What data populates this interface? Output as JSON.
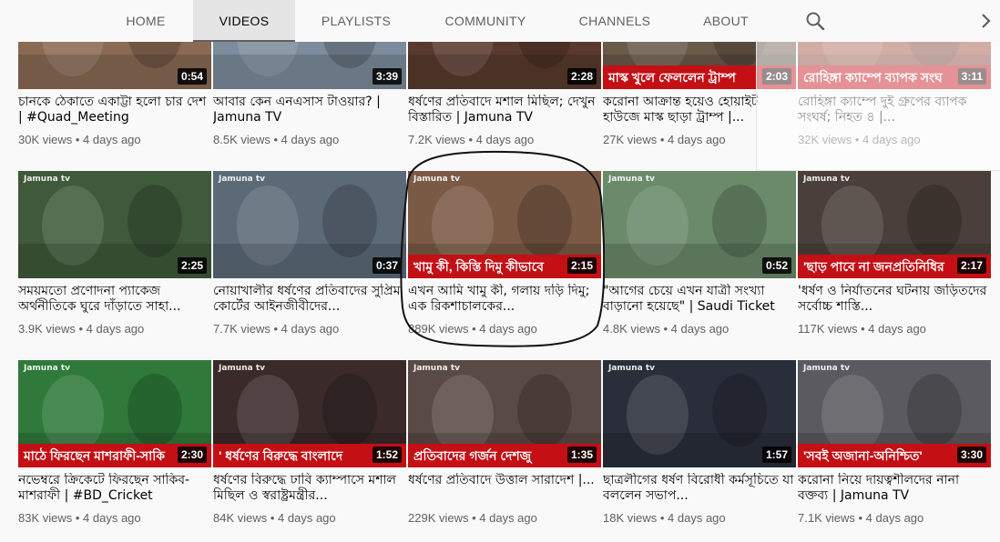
{
  "tabs": {
    "items": [
      {
        "label": "HOME"
      },
      {
        "label": "VIDEOS"
      },
      {
        "label": "PLAYLISTS"
      },
      {
        "label": "COMMUNITY"
      },
      {
        "label": "CHANNELS"
      },
      {
        "label": "ABOUT"
      }
    ],
    "active": "VIDEOS",
    "search_icon": "search-icon",
    "next_icon": "chevron-right-icon"
  },
  "videos": [
    {
      "duration": "0:54",
      "title": "চানকে ঠেকাতে একাট্টা হলো চার দেশ | #Quad_Meeting",
      "views": "30K views",
      "age": "4 days ago",
      "banner": ""
    },
    {
      "duration": "3:39",
      "title": "আবার কেন এনএসাস টাওয়ার? | Jamuna TV",
      "views": "8.5K views",
      "age": "4 days ago",
      "banner": ""
    },
    {
      "duration": "2:28",
      "title": "ধর্ষণের প্রতিবাদে মশাল মিছিল; দেখুন বিস্তারিত | Jamuna TV",
      "views": "7.2K views",
      "age": "4 days ago",
      "banner": ""
    },
    {
      "duration": "2:03",
      "title": "করোনা আক্রান্ত হয়েও হোয়াইট হাউজে মাস্ক ছাড়া ট্রাম্প |...",
      "views": "27K views",
      "age": "4 days ago",
      "banner": "মাস্ক খুলে ফেললেন ট্রাম্প"
    },
    {
      "duration": "3:11",
      "title": "রোহিঙ্গা ক্যাম্পে দুই গ্রুপের ব্যাপক সংঘর্ষ; নিহত ৪ |...",
      "views": "32K views",
      "age": "4 days ago",
      "banner": "রোহিঙ্গা ক্যাম্পে ব্যাপক সংঘ"
    },
    {
      "duration": "2:25",
      "title": "সময়মতো প্রণোদনা প্যাকেজ অর্থনীতিকে ঘুরে দাঁড়াতে সাহা...",
      "views": "3.9K views",
      "age": "4 days ago",
      "banner": ""
    },
    {
      "duration": "0:37",
      "title": "নোয়াখালীর ধর্ষণের প্রতিবাদের সুপ্রিম কোর্টের আইনজীবীদের...",
      "views": "7.7K views",
      "age": "4 days ago",
      "banner": ""
    },
    {
      "duration": "2:15",
      "title": "এখন আমি খামু কী, গলায় দড়ি দিমু; এক রিকশাচালকের...",
      "views": "889K views",
      "age": "4 days ago",
      "banner": "খামু কী, কিস্তি দিমু কীভাবে"
    },
    {
      "duration": "0:52",
      "title": "\"আগের চেয়ে এখন যাত্রী সংখ্যা বাড়ানো হয়েছে\" | Saudi Ticket",
      "views": "4.8K views",
      "age": "4 days ago",
      "banner": ""
    },
    {
      "duration": "2:17",
      "title": "'ধর্ষণ ও নির্যাতনের ঘটনায় জড়িতদের সর্বোচ্চ শাস্তি...",
      "views": "117K views",
      "age": "4 days ago",
      "banner": "'ছাড় পাবে না জনপ্রতিনিধির"
    },
    {
      "duration": "2:30",
      "title": "নভেম্বরে ক্রিকেটে ফিরছেন সাকিব-মাশরাফী | #BD_Cricket",
      "views": "83K views",
      "age": "4 days ago",
      "banner": "মাঠে ফিরছেন মাশরাফী-সাকি"
    },
    {
      "duration": "1:52",
      "title": "ধর্ষণের বিরুদ্ধে ঢাবি ক্যাম্পাসে মশাল মিছিল ও স্বরাষ্ট্রমন্ত্রীর...",
      "views": "84K views",
      "age": "4 days ago",
      "banner": "' ধর্ষণের বিরুদ্ধে বাংলাদে"
    },
    {
      "duration": "1:35",
      "title": "ধর্ষণের প্রতিবাদে উত্তাল সারাদেশ |...",
      "views": "229K views",
      "age": "4 days ago",
      "banner": "প্রতিবাদের গর্জন দেশজু"
    },
    {
      "duration": "1:57",
      "title": "ছাত্রলীগের ধর্ষণ বিরোধী কর্মসূচিতে যা বললেন সভাপ...",
      "views": "18K views",
      "age": "4 days ago",
      "banner": ""
    },
    {
      "duration": "3:30",
      "title": "করোনা নিয়ে দায়ত্বশীলদের নানা বক্তব্য | Jamuna TV",
      "views": "7.1K views",
      "age": "4 days ago",
      "banner": "'সবই অজানা-অনিশ্চিত'"
    }
  ],
  "thumb_colors": [
    "#8a6a55",
    "#7d8c9c",
    "#5a3a2e",
    "#6a5a4a",
    "#9c4a3a",
    "#3f5a3a",
    "#5c6a78",
    "#7a5a45",
    "#6a8a6a",
    "#4a3f3a",
    "#2f7a3a",
    "#3a2a2a",
    "#5a4a45",
    "#2a2e3a",
    "#5a5a60"
  ],
  "logo_text": "Jamuna tv"
}
